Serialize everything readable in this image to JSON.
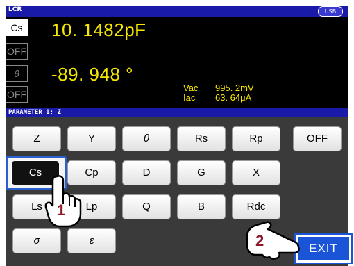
{
  "header": {
    "mode": "LCR",
    "usb": "USB"
  },
  "measurement": {
    "param1": {
      "label": "Cs",
      "value": "10. 1482pF"
    },
    "param2": {
      "label": "OFF"
    },
    "param3": {
      "label": "θ",
      "value": "-89. 948 °"
    },
    "param4": {
      "label": "OFF"
    },
    "monitor": {
      "vac_label": "Vac",
      "vac_value": "995. 2mV",
      "iac_label": "Iac",
      "iac_value": "63. 64μA"
    }
  },
  "param_bar": "PARAMETER 1:  Z",
  "buttons": {
    "row1": [
      "Z",
      "Y",
      "θ",
      "Rs",
      "Rp",
      "OFF"
    ],
    "row2": [
      "Cs",
      "Cp",
      "D",
      "G",
      "X"
    ],
    "row3": [
      "Ls",
      "Lp",
      "Q",
      "B",
      "Rdc"
    ],
    "row4": [
      "σ",
      "ε"
    ],
    "exit": "EXIT"
  },
  "selected": "Cs",
  "steps": {
    "step1": "1",
    "step2": "2"
  },
  "colors": {
    "value": "#f6e800",
    "bar": "#1a1aa8",
    "exit": "#1a55d8",
    "step_number": "#8b1a2a"
  }
}
